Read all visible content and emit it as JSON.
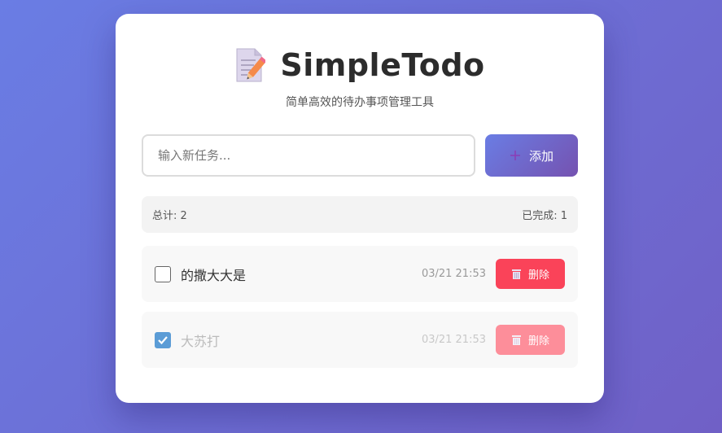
{
  "app": {
    "title": "SimpleTodo",
    "subtitle": "简单高效的待办事项管理工具",
    "logo_icon": "memo-pencil-icon"
  },
  "input": {
    "placeholder": "输入新任务...",
    "value": ""
  },
  "add_button": {
    "label": "添加",
    "icon": "plus-icon"
  },
  "stats": {
    "total_label": "总计: 2",
    "completed_label": "已完成: 1"
  },
  "todos": [
    {
      "text": "的撒大大是",
      "time": "03/21 21:53",
      "completed": false,
      "delete_label": "删除"
    },
    {
      "text": "大苏打",
      "time": "03/21 21:53",
      "completed": true,
      "delete_label": "删除"
    }
  ],
  "colors": {
    "gradient_start": "#6a7de4",
    "gradient_end": "#7060c6",
    "delete_red": "#fa4359",
    "checkbox_blue": "#5b9cd6"
  }
}
